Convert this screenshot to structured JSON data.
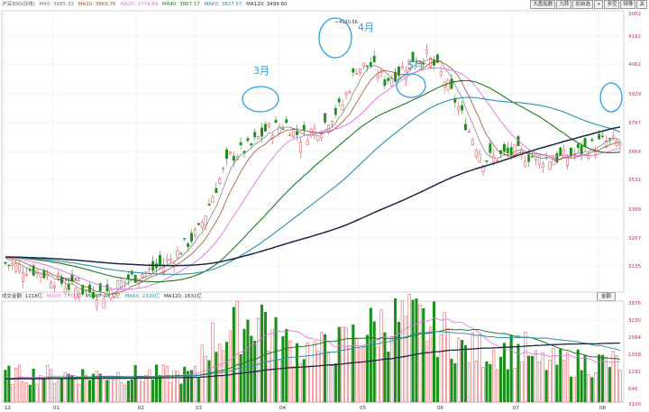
{
  "price_legend": {
    "items": [
      {
        "text": "沪深300(日线)",
        "color": "#555555"
      },
      {
        "text": "MA5: 3685.33",
        "color": "#777777"
      },
      {
        "text": "MA10: 3869.76",
        "color": "#a0522d"
      },
      {
        "text": "MA20: 3774.89",
        "color": "#e070e0"
      },
      {
        "text": "MA40: 3867.17",
        "color": "#1e7b1e"
      },
      {
        "text": "MA60: 3827.57",
        "color": "#2b8fb0"
      },
      {
        "text": "MA120: 3499.60",
        "color": "#1a2a44"
      }
    ]
  },
  "volume_legend": {
    "items": [
      {
        "text": "成交金额: 1218亿",
        "color": "#333333"
      },
      {
        "text": "MA20: 1765亿",
        "color": "#e070e0"
      },
      {
        "text": "MA40: 2061亿",
        "color": "#1e7b1e"
      },
      {
        "text": "MA60: 2320亿",
        "color": "#2b8fb0"
      },
      {
        "text": "MA120: 1631亿",
        "color": "#1a2a44"
      }
    ]
  },
  "toolbar": [
    "大盘指数",
    "九转",
    "加自选",
    "+",
    "多空",
    "特殊",
    "关"
  ],
  "volume_button": "金额",
  "chart_data": {
    "type": "candlestick",
    "price_ticks": [
      "4192",
      "4062",
      "3929",
      "3797",
      "3664",
      "3532",
      "3399",
      "3267",
      "3135",
      "3002"
    ],
    "volume_ticks": [
      "3876",
      "3230",
      "2584",
      "1938",
      "1292",
      "646",
      "X100"
    ],
    "x_ticks": [
      "12",
      "01",
      "02",
      "03",
      "04",
      "05",
      "06",
      "07",
      "08"
    ],
    "annotations": [
      {
        "label": "3月",
        "kind": "circle",
        "color": "#2aa0e6"
      },
      {
        "label": "4月",
        "kind": "circle",
        "color": "#2aa0e6"
      },
      {
        "label": "5月",
        "kind": "circle",
        "color": "#2aa0e6"
      },
      {
        "label": "",
        "kind": "circle",
        "color": "#2aa0e6"
      }
    ],
    "max_label": "4120.56",
    "min_label": "2935.83",
    "series_colors": {
      "ma5": "#777777",
      "ma10": "#a0522d",
      "ma20": "#e070e0",
      "ma40": "#1e7b1e",
      "ma60": "#2b8fb0",
      "ma120": "#1a2a44",
      "up": "#e0474c",
      "down": "#1a8f1a"
    }
  }
}
